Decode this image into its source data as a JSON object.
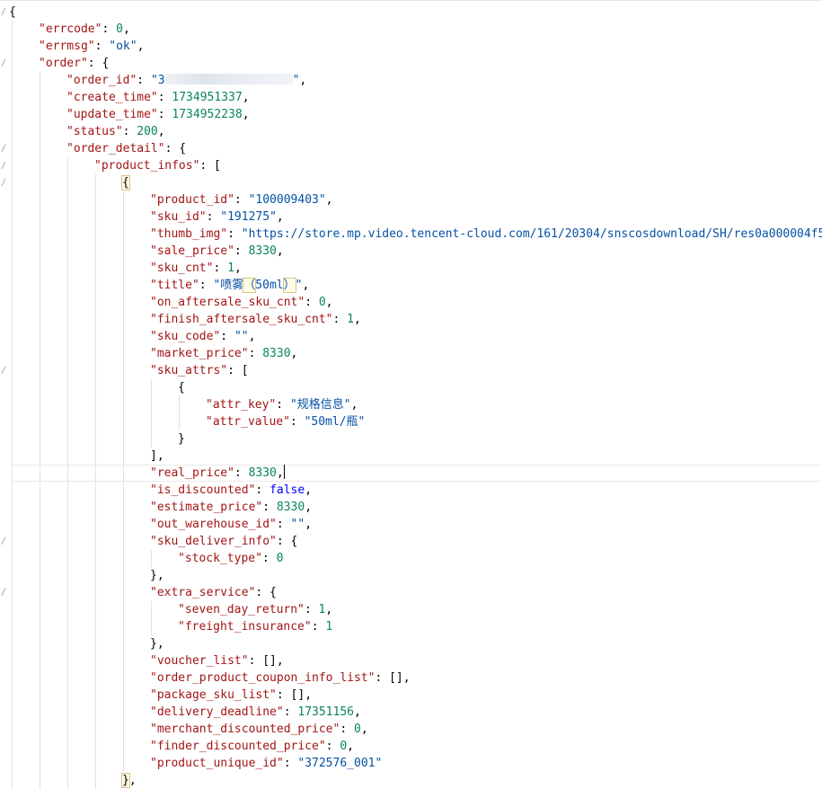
{
  "lines": [
    {
      "indent": 0,
      "tokens": [
        {
          "t": "{",
          "c": "p"
        }
      ]
    },
    {
      "indent": 1,
      "tokens": [
        {
          "t": "\"errcode\"",
          "c": "k"
        },
        {
          "t": ": ",
          "c": "p"
        },
        {
          "t": "0",
          "c": "n"
        },
        {
          "t": ",",
          "c": "p"
        }
      ]
    },
    {
      "indent": 1,
      "tokens": [
        {
          "t": "\"errmsg\"",
          "c": "k"
        },
        {
          "t": ": ",
          "c": "p"
        },
        {
          "t": "\"ok\"",
          "c": "s"
        },
        {
          "t": ",",
          "c": "p"
        }
      ]
    },
    {
      "indent": 1,
      "tokens": [
        {
          "t": "\"order\"",
          "c": "k"
        },
        {
          "t": ": {",
          "c": "p"
        }
      ]
    },
    {
      "indent": 2,
      "tokens": [
        {
          "t": "\"order_id\"",
          "c": "k"
        },
        {
          "t": ": ",
          "c": "p"
        },
        {
          "t": "\"3",
          "c": "s"
        },
        {
          "t": "",
          "c": "blur"
        },
        {
          "t": "\"",
          "c": "s"
        },
        {
          "t": ",",
          "c": "p"
        }
      ]
    },
    {
      "indent": 2,
      "tokens": [
        {
          "t": "\"create_time\"",
          "c": "k"
        },
        {
          "t": ": ",
          "c": "p"
        },
        {
          "t": "1734951337",
          "c": "n"
        },
        {
          "t": ",",
          "c": "p"
        }
      ]
    },
    {
      "indent": 2,
      "tokens": [
        {
          "t": "\"update_time\"",
          "c": "k"
        },
        {
          "t": ": ",
          "c": "p"
        },
        {
          "t": "1734952238",
          "c": "n"
        },
        {
          "t": ",",
          "c": "p"
        }
      ]
    },
    {
      "indent": 2,
      "tokens": [
        {
          "t": "\"status\"",
          "c": "k"
        },
        {
          "t": ": ",
          "c": "p"
        },
        {
          "t": "200",
          "c": "n"
        },
        {
          "t": ",",
          "c": "p"
        }
      ]
    },
    {
      "indent": 2,
      "tokens": [
        {
          "t": "\"order_detail\"",
          "c": "k"
        },
        {
          "t": ": {",
          "c": "p"
        }
      ]
    },
    {
      "indent": 3,
      "tokens": [
        {
          "t": "\"product_infos\"",
          "c": "k"
        },
        {
          "t": ": [",
          "c": "p"
        }
      ]
    },
    {
      "indent": 4,
      "tokens": [
        {
          "t": "{",
          "c": "p",
          "box": true
        }
      ]
    },
    {
      "indent": 5,
      "tokens": [
        {
          "t": "\"product_id\"",
          "c": "k"
        },
        {
          "t": ": ",
          "c": "p"
        },
        {
          "t": "\"100009403\"",
          "c": "s"
        },
        {
          "t": ",",
          "c": "p"
        }
      ]
    },
    {
      "indent": 5,
      "tokens": [
        {
          "t": "\"sku_id\"",
          "c": "k"
        },
        {
          "t": ": ",
          "c": "p"
        },
        {
          "t": "\"191275\"",
          "c": "s"
        },
        {
          "t": ",",
          "c": "p"
        }
      ]
    },
    {
      "indent": 5,
      "tokens": [
        {
          "t": "\"thumb_img\"",
          "c": "k"
        },
        {
          "t": ": ",
          "c": "p"
        },
        {
          "t": "\"https://store.mp.video.tencent-cloud.com/161/20304/snscosdownload/SH/res0a000004f50",
          "c": "s"
        }
      ]
    },
    {
      "indent": 5,
      "tokens": [
        {
          "t": "\"sale_price\"",
          "c": "k"
        },
        {
          "t": ": ",
          "c": "p"
        },
        {
          "t": "8330",
          "c": "n"
        },
        {
          "t": ",",
          "c": "p"
        }
      ]
    },
    {
      "indent": 5,
      "tokens": [
        {
          "t": "\"sku_cnt\"",
          "c": "k"
        },
        {
          "t": ": ",
          "c": "p"
        },
        {
          "t": "1",
          "c": "n"
        },
        {
          "t": ",",
          "c": "p"
        }
      ]
    },
    {
      "indent": 5,
      "tokens": [
        {
          "t": "\"title\"",
          "c": "k"
        },
        {
          "t": ": ",
          "c": "p"
        },
        {
          "t": "\"喷雾",
          "c": "s"
        },
        {
          "t": "（",
          "c": "s",
          "box": true
        },
        {
          "t": "50ml",
          "c": "s"
        },
        {
          "t": "）",
          "c": "s",
          "box": true
        },
        {
          "t": "\"",
          "c": "s"
        },
        {
          "t": ",",
          "c": "p"
        }
      ]
    },
    {
      "indent": 5,
      "tokens": [
        {
          "t": "\"on_aftersale_sku_cnt\"",
          "c": "k"
        },
        {
          "t": ": ",
          "c": "p"
        },
        {
          "t": "0",
          "c": "n"
        },
        {
          "t": ",",
          "c": "p"
        }
      ]
    },
    {
      "indent": 5,
      "tokens": [
        {
          "t": "\"finish_aftersale_sku_cnt\"",
          "c": "k"
        },
        {
          "t": ": ",
          "c": "p"
        },
        {
          "t": "1",
          "c": "n"
        },
        {
          "t": ",",
          "c": "p"
        }
      ]
    },
    {
      "indent": 5,
      "tokens": [
        {
          "t": "\"sku_code\"",
          "c": "k"
        },
        {
          "t": ": ",
          "c": "p"
        },
        {
          "t": "\"\"",
          "c": "s"
        },
        {
          "t": ",",
          "c": "p"
        }
      ]
    },
    {
      "indent": 5,
      "tokens": [
        {
          "t": "\"market_price\"",
          "c": "k"
        },
        {
          "t": ": ",
          "c": "p"
        },
        {
          "t": "8330",
          "c": "n"
        },
        {
          "t": ",",
          "c": "p"
        }
      ]
    },
    {
      "indent": 5,
      "tokens": [
        {
          "t": "\"sku_attrs\"",
          "c": "k"
        },
        {
          "t": ": [",
          "c": "p"
        }
      ]
    },
    {
      "indent": 6,
      "tokens": [
        {
          "t": "{",
          "c": "p"
        }
      ]
    },
    {
      "indent": 7,
      "tokens": [
        {
          "t": "\"attr_key\"",
          "c": "k"
        },
        {
          "t": ": ",
          "c": "p"
        },
        {
          "t": "\"规格信息\"",
          "c": "s"
        },
        {
          "t": ",",
          "c": "p"
        }
      ]
    },
    {
      "indent": 7,
      "tokens": [
        {
          "t": "\"attr_value\"",
          "c": "k"
        },
        {
          "t": ": ",
          "c": "p"
        },
        {
          "t": "\"50ml/瓶\"",
          "c": "s"
        }
      ]
    },
    {
      "indent": 6,
      "tokens": [
        {
          "t": "}",
          "c": "p"
        }
      ]
    },
    {
      "indent": 5,
      "tokens": [
        {
          "t": "],",
          "c": "p"
        }
      ]
    },
    {
      "indent": 5,
      "current": true,
      "tokens": [
        {
          "t": "\"real_price\"",
          "c": "k"
        },
        {
          "t": ": ",
          "c": "p"
        },
        {
          "t": "8330",
          "c": "n"
        },
        {
          "t": ",",
          "c": "p"
        },
        {
          "t": "",
          "c": "caret"
        }
      ]
    },
    {
      "indent": 5,
      "tokens": [
        {
          "t": "\"is_discounted\"",
          "c": "k"
        },
        {
          "t": ": ",
          "c": "p"
        },
        {
          "t": "false",
          "c": "b"
        },
        {
          "t": ",",
          "c": "p"
        }
      ]
    },
    {
      "indent": 5,
      "tokens": [
        {
          "t": "\"estimate_price\"",
          "c": "k"
        },
        {
          "t": ": ",
          "c": "p"
        },
        {
          "t": "8330",
          "c": "n"
        },
        {
          "t": ",",
          "c": "p"
        }
      ]
    },
    {
      "indent": 5,
      "tokens": [
        {
          "t": "\"out_warehouse_id\"",
          "c": "k"
        },
        {
          "t": ": ",
          "c": "p"
        },
        {
          "t": "\"\"",
          "c": "s"
        },
        {
          "t": ",",
          "c": "p"
        }
      ]
    },
    {
      "indent": 5,
      "tokens": [
        {
          "t": "\"sku_deliver_info\"",
          "c": "k"
        },
        {
          "t": ": {",
          "c": "p"
        }
      ]
    },
    {
      "indent": 6,
      "tokens": [
        {
          "t": "\"stock_type\"",
          "c": "k"
        },
        {
          "t": ": ",
          "c": "p"
        },
        {
          "t": "0",
          "c": "n"
        }
      ]
    },
    {
      "indent": 5,
      "tokens": [
        {
          "t": "},",
          "c": "p"
        }
      ]
    },
    {
      "indent": 5,
      "tokens": [
        {
          "t": "\"extra_service\"",
          "c": "k"
        },
        {
          "t": ": {",
          "c": "p"
        }
      ]
    },
    {
      "indent": 6,
      "tokens": [
        {
          "t": "\"seven_day_return\"",
          "c": "k"
        },
        {
          "t": ": ",
          "c": "p"
        },
        {
          "t": "1",
          "c": "n"
        },
        {
          "t": ",",
          "c": "p"
        }
      ]
    },
    {
      "indent": 6,
      "tokens": [
        {
          "t": "\"freight_insurance\"",
          "c": "k"
        },
        {
          "t": ": ",
          "c": "p"
        },
        {
          "t": "1",
          "c": "n"
        }
      ]
    },
    {
      "indent": 5,
      "tokens": [
        {
          "t": "},",
          "c": "p"
        }
      ]
    },
    {
      "indent": 5,
      "tokens": [
        {
          "t": "\"voucher_list\"",
          "c": "k"
        },
        {
          "t": ": [],",
          "c": "p"
        }
      ]
    },
    {
      "indent": 5,
      "tokens": [
        {
          "t": "\"order_product_coupon_info_list\"",
          "c": "k"
        },
        {
          "t": ": [],",
          "c": "p"
        }
      ]
    },
    {
      "indent": 5,
      "tokens": [
        {
          "t": "\"package_sku_list\"",
          "c": "k"
        },
        {
          "t": ": [],",
          "c": "p"
        }
      ]
    },
    {
      "indent": 5,
      "tokens": [
        {
          "t": "\"delivery_deadline\"",
          "c": "k"
        },
        {
          "t": ": ",
          "c": "p"
        },
        {
          "t": "17351156",
          "c": "n"
        },
        {
          "t": ",",
          "c": "p"
        }
      ]
    },
    {
      "indent": 5,
      "tokens": [
        {
          "t": "\"merchant_discounted_price\"",
          "c": "k"
        },
        {
          "t": ": ",
          "c": "p"
        },
        {
          "t": "0",
          "c": "n"
        },
        {
          "t": ",",
          "c": "p"
        }
      ]
    },
    {
      "indent": 5,
      "tokens": [
        {
          "t": "\"finder_discounted_price\"",
          "c": "k"
        },
        {
          "t": ": ",
          "c": "p"
        },
        {
          "t": "0",
          "c": "n"
        },
        {
          "t": ",",
          "c": "p"
        }
      ]
    },
    {
      "indent": 5,
      "tokens": [
        {
          "t": "\"product_unique_id\"",
          "c": "k"
        },
        {
          "t": ": ",
          "c": "p"
        },
        {
          "t": "\"372576_001\"",
          "c": "s"
        }
      ]
    },
    {
      "indent": 4,
      "tokens": [
        {
          "t": "}",
          "c": "p",
          "box": true
        },
        {
          "t": ",",
          "c": "p"
        }
      ]
    }
  ],
  "fold_marks": [
    0,
    3,
    8,
    9,
    10,
    21,
    31,
    34
  ],
  "icons": {
    "fold": "fold-chevron-icon"
  },
  "colors": {
    "key": "#a31515",
    "string": "#0451a5",
    "number": "#098658",
    "boolean": "#0000ff",
    "punctuation": "#000000"
  }
}
